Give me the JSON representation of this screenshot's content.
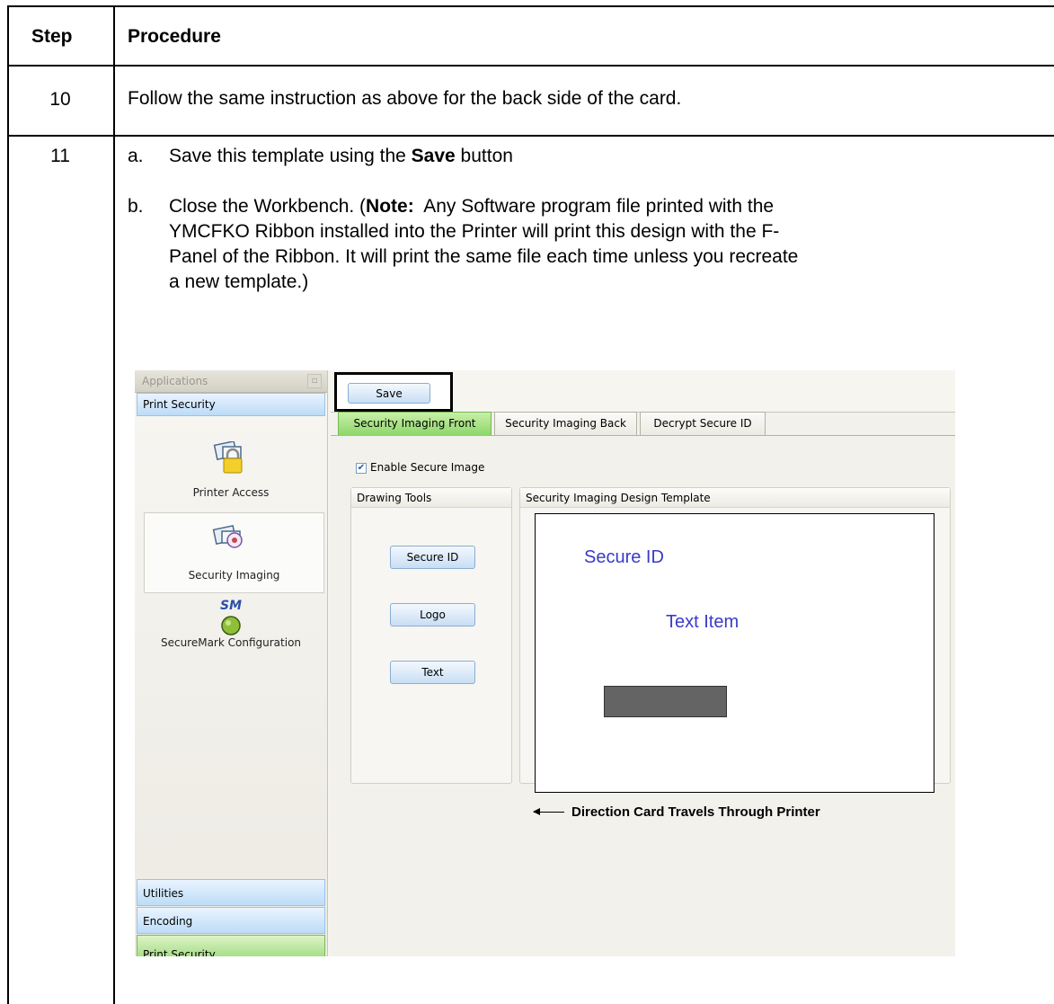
{
  "table": {
    "header_step": "Step",
    "header_procedure": "Procedure",
    "rows": [
      {
        "step": "10",
        "text": "Follow the same instruction as above for the back side of the card."
      },
      {
        "step": "11",
        "items": [
          {
            "label": "a.",
            "pre": "Save this template using the ",
            "bold": "Save",
            "post": " button"
          },
          {
            "label": "b.",
            "line1_pre": "Close the Workbench. (",
            "note_bold": "Note:",
            "line1_post": "  Any Software program file printed with the",
            "line2": "YMCFKO Ribbon installed into the Printer will print this design with the F-",
            "line3": "Panel of the Ribbon. It will print the same file each time unless you recreate",
            "line4": "a new template.)"
          }
        ]
      }
    ]
  },
  "screenshot": {
    "sidebar": {
      "title": "Applications",
      "section": "Print Security",
      "items": [
        {
          "label": "Printer Access",
          "icon": "lock-card-icon"
        },
        {
          "label": "Security Imaging",
          "icon": "security-imaging-icon"
        },
        {
          "label": "SecureMark Configuration",
          "icon": "securemark-icon",
          "badge": "SM"
        }
      ],
      "bottom_bars": [
        "Utilities",
        "Encoding",
        "Print Security"
      ]
    },
    "save_button": "Save",
    "tabs": [
      "Security Imaging Front",
      "Security Imaging Back",
      "Decrypt Secure ID"
    ],
    "enable_checkbox": "Enable Secure Image",
    "drawing_tools": {
      "title": "Drawing Tools",
      "buttons": [
        "Secure ID",
        "Logo",
        "Text"
      ]
    },
    "design_template": {
      "title": "Security Imaging Design Template",
      "secure_id_text": "Secure ID",
      "text_item": "Text Item"
    },
    "direction_caption": "Direction Card Travels Through Printer",
    "colors": {
      "active_tab": "#8ed66a",
      "canvas_text": "#3a3ac8",
      "logo_block": "#646464"
    }
  }
}
